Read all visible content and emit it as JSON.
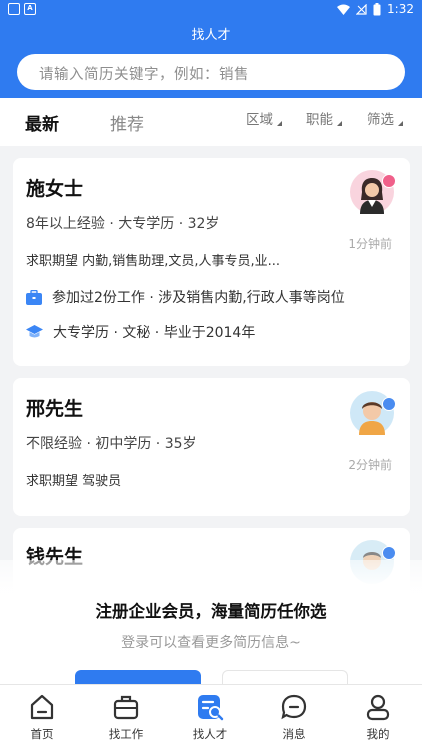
{
  "status_bar": {
    "time": "1:32"
  },
  "header": {
    "title": "找人才",
    "search_placeholder": "请输入简历关键字，例如：销售"
  },
  "tabs": [
    {
      "label": "最新",
      "active": true
    },
    {
      "label": "推荐",
      "active": false
    }
  ],
  "filters": [
    {
      "label": "区域"
    },
    {
      "label": "职能"
    },
    {
      "label": "筛选"
    }
  ],
  "candidates": [
    {
      "name": "施女士",
      "meta": "8年以上经验 · 大专学历 · 32岁",
      "expectation": "求职期望 内勤,销售助理,文员,人事专员,业...",
      "time": "1分钟前",
      "work": "参加过2份工作 · 涉及销售内勤,行政人事等岗位",
      "edu": "大专学历 · 文秘 · 毕业于2014年",
      "gender": "female"
    },
    {
      "name": "邢先生",
      "meta": "不限经验 · 初中学历 · 35岁",
      "expectation": "求职期望 驾驶员",
      "time": "2分钟前",
      "gender": "male"
    },
    {
      "name": "钱先生",
      "gender": "male"
    }
  ],
  "login_prompt": {
    "title": "注册企业会员，海量简历任你选",
    "subtitle": "登录可以查看更多简历信息~"
  },
  "bottom_nav": [
    {
      "label": "首页",
      "icon": "home-icon",
      "active": false
    },
    {
      "label": "找工作",
      "icon": "briefcase-icon",
      "active": false
    },
    {
      "label": "找人才",
      "icon": "resume-search-icon",
      "active": true
    },
    {
      "label": "消息",
      "icon": "message-icon",
      "active": false
    },
    {
      "label": "我的",
      "icon": "profile-icon",
      "active": false
    }
  ],
  "colors": {
    "primary": "#2f7bf0",
    "female_badge": "#f0608a",
    "male_badge": "#4a8cf0"
  }
}
